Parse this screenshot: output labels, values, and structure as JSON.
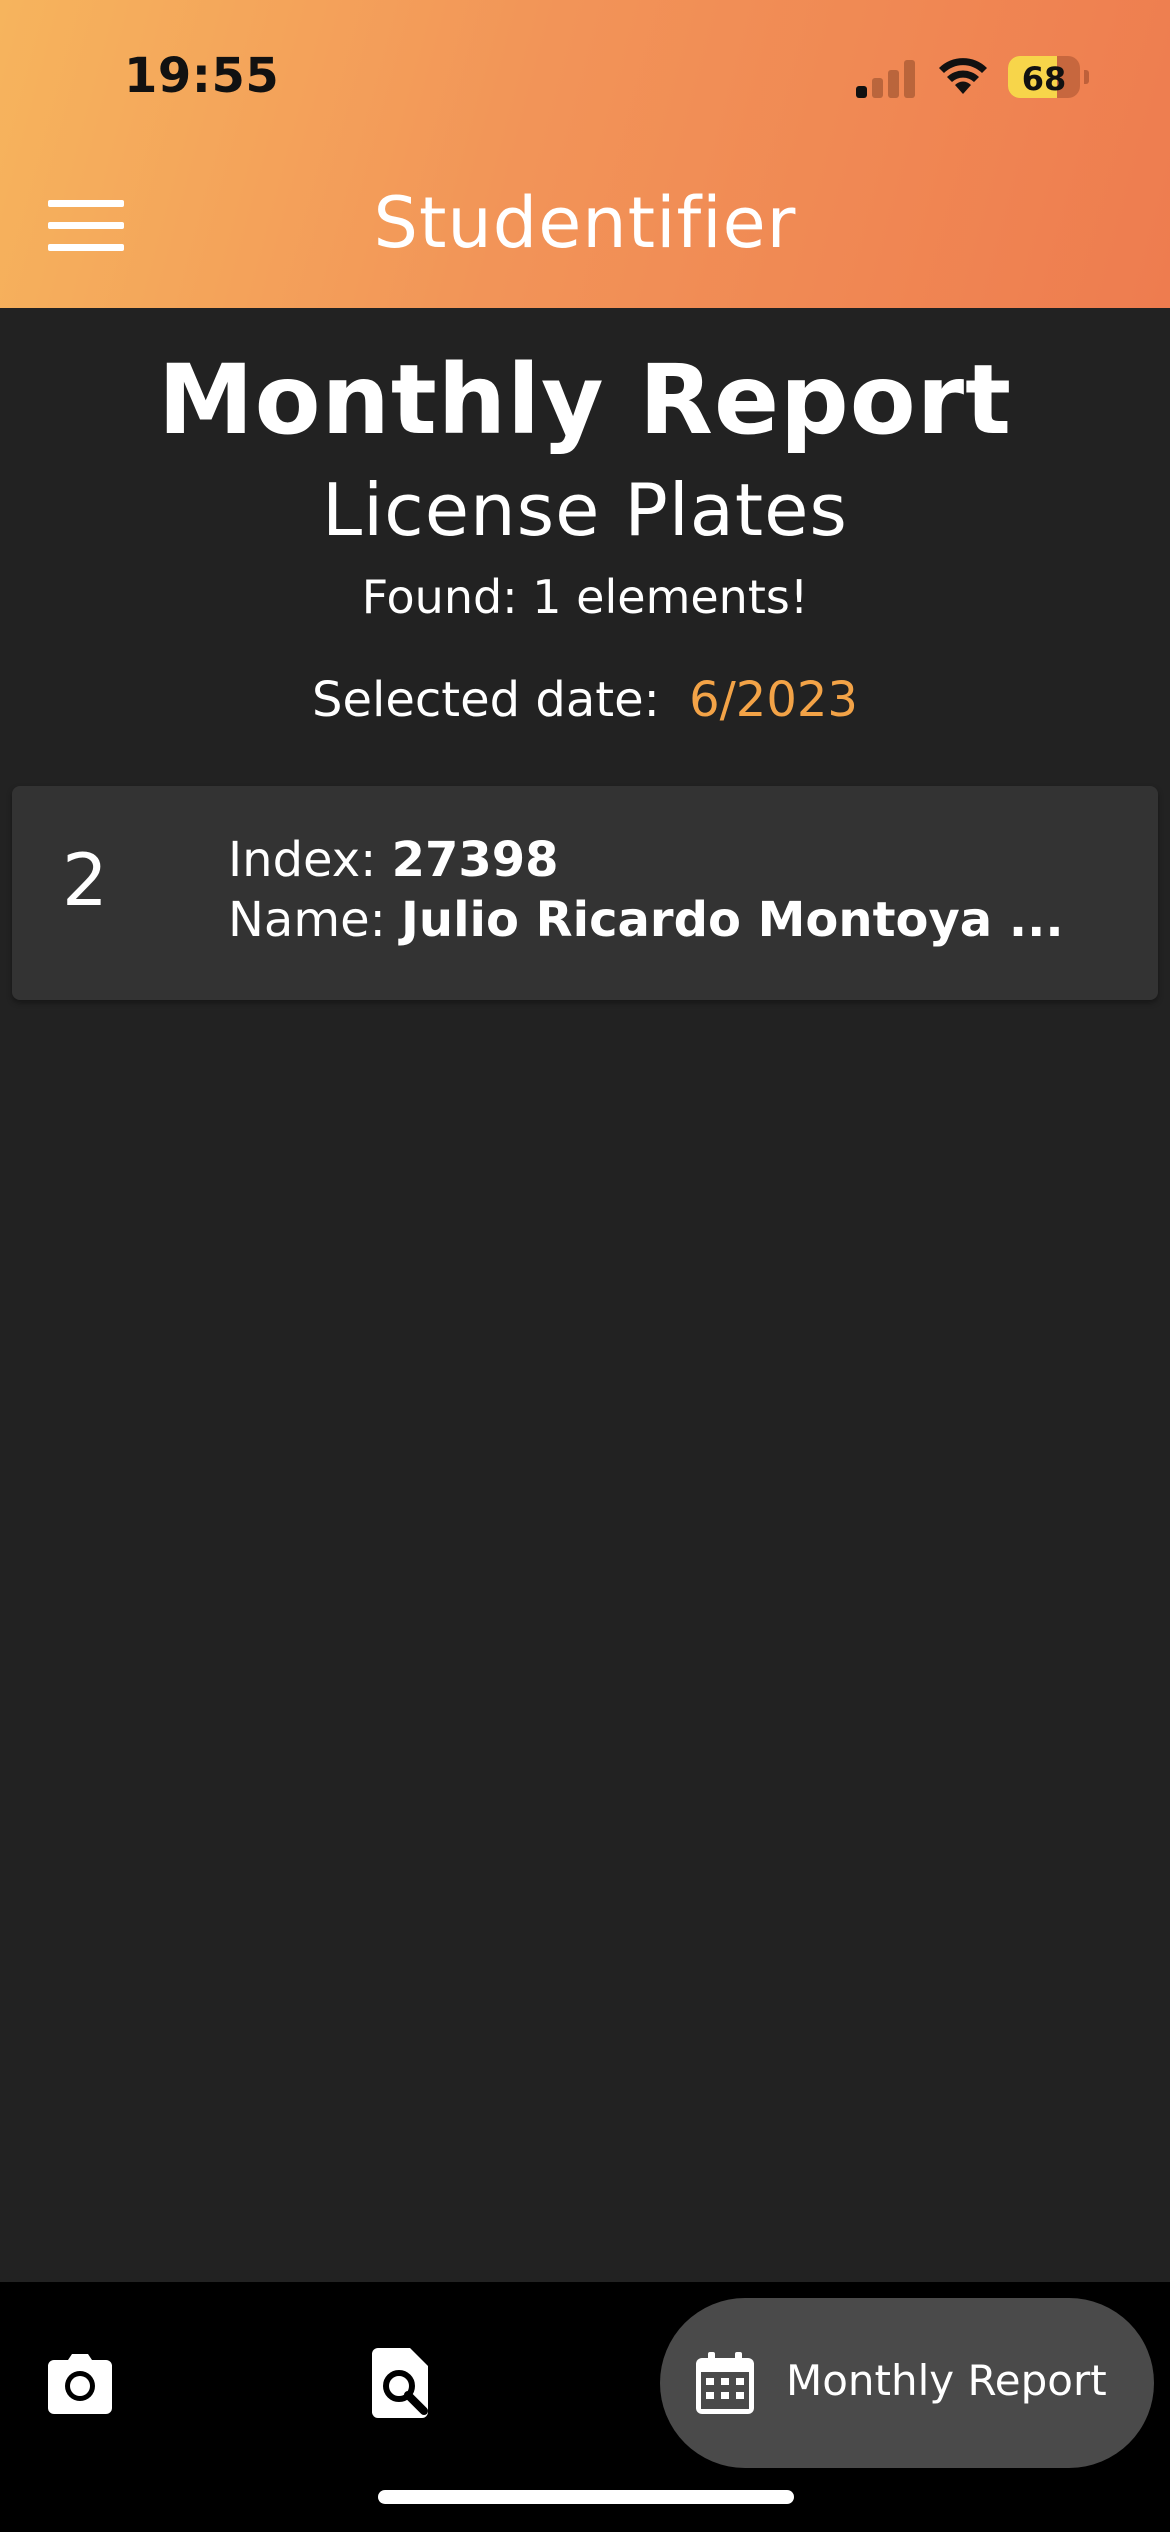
{
  "status_bar": {
    "time": "19:55",
    "battery_level": "68"
  },
  "app_bar": {
    "title": "Studentifier",
    "menu_icon": "hamburger-menu-icon"
  },
  "main": {
    "title": "Monthly Report",
    "subtitle": "License Plates",
    "found_text": "Found: 1 elements!",
    "selected_date_label": "Selected date:",
    "selected_date_value": "6/2023"
  },
  "results": [
    {
      "number": "2",
      "index_label": "Index:",
      "index_value": "27398",
      "name_label": "Name:",
      "name_value": "Julio Ricardo Montoya ..."
    }
  ],
  "bottom_nav": {
    "items": [
      {
        "icon": "camera-icon"
      },
      {
        "icon": "search-document-icon"
      },
      {
        "icon": "calendar-icon",
        "label": "Monthly Report",
        "active": true
      }
    ]
  },
  "colors": {
    "header_gradient_start": "#f6b45d",
    "header_gradient_end": "#ee7c4f",
    "accent": "#f3a347",
    "background": "#222222",
    "card": "#333333"
  }
}
